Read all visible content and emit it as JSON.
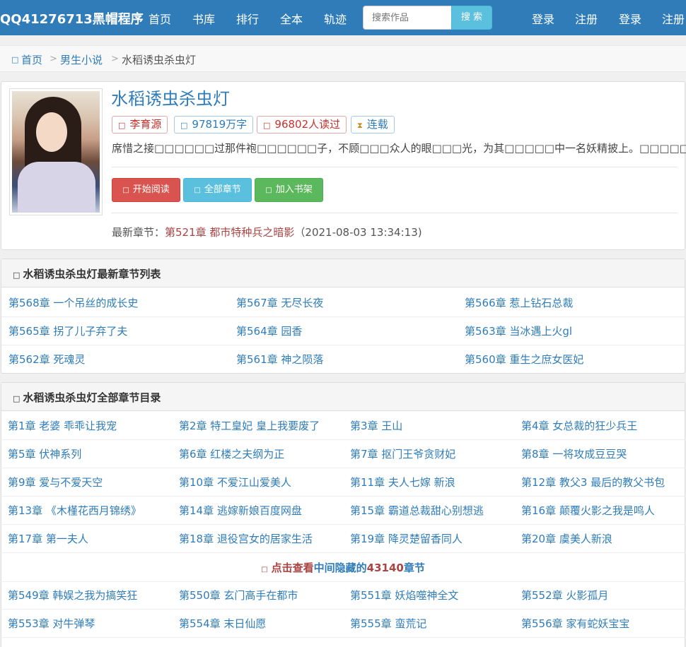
{
  "nav": {
    "brand": "QQ41276713黑帽程序",
    "items": [
      "首页",
      "书库",
      "排行",
      "全本",
      "轨迹"
    ],
    "search_placeholder": "搜索作品",
    "search_button": "搜 索",
    "right_links": [
      "登录",
      "注册",
      "登录",
      "注册"
    ]
  },
  "breadcrumb": {
    "home_icon": "home-icon",
    "home": "首页",
    "sep": ">",
    "category": "男生小说",
    "current": "水稻诱虫杀虫灯"
  },
  "book": {
    "title": "水稻诱虫杀虫灯",
    "author": "李育源",
    "words": "97819万字",
    "readers": "96802人读过",
    "status": "连载",
    "intro": "席惜之接□□□□□□过那件袍□□□□□□子，不顾□□□众人的眼□□□光，为其□□□□□中一名妖精披上。□□□□□",
    "buttons": {
      "start_read": "开始阅读",
      "all_chapters": "全部章节",
      "add_shelf": "加入书架"
    },
    "latest_label": "最新章节：",
    "latest_chapter": "第521章 都市特种兵之暗影",
    "latest_time": "（2021-08-03 13:34:13)"
  },
  "latest_list": {
    "title": "水稻诱虫杀虫灯最新章节列表",
    "rows": [
      [
        "第568章 一个吊丝的成长史",
        "第567章 无尽长夜",
        "第566章 惹上钻石总裁"
      ],
      [
        "第565章 拐了儿子弃了夫",
        "第564章 园香",
        "第563章 当冰遇上火gl"
      ],
      [
        "第562章 死魂灵",
        "第561章 神之陨落",
        "第560章 重生之庶女医妃"
      ]
    ]
  },
  "all_list": {
    "title": "水稻诱虫杀虫灯全部章节目录",
    "rows_top": [
      [
        "第1章 老婆 乖乖让我宠",
        "第2章 特工皇妃 皇上我要废了",
        "第3章 王山",
        "第4章 女总裁的狂少兵王"
      ],
      [
        "第5章 伏神系列",
        "第6章 红楼之夫纲为正",
        "第7章 抠门王爷贪财妃",
        "第8章 一将攻成豆豆哭"
      ],
      [
        "第9章 爱与不爱天空",
        "第10章 不爱江山爱美人",
        "第11章 夫人七嫁 新浪",
        "第12章 教父3 最后的教父书包"
      ],
      [
        "第13章 《木槿花西月锦绣》",
        "第14章 逃嫁新娘百度网盘",
        "第15章 霸道总裁甜心别想逃",
        "第16章 颠覆火影之我是鸣人"
      ],
      [
        "第17章 第一夫人",
        "第18章 退役宫女的居家生活",
        "第19章 降灵楚留香同人",
        "第20章 虞美人新浪"
      ]
    ],
    "hidden_prefix": "点击查看",
    "hidden_mid": "中间隐藏的",
    "hidden_count": "43140",
    "hidden_suffix": "章节",
    "rows_bottom": [
      [
        "第549章 韩娱之我为搞笑狂",
        "第550章 玄门高手在都市",
        "第551章 妖焰噬神全文",
        "第552章 火影孤月"
      ],
      [
        "第553章 对牛弹琴",
        "第554章 末日仙愿",
        "第555章 蛮荒记",
        "第556章 家有蛇妖宝宝"
      ]
    ]
  }
}
